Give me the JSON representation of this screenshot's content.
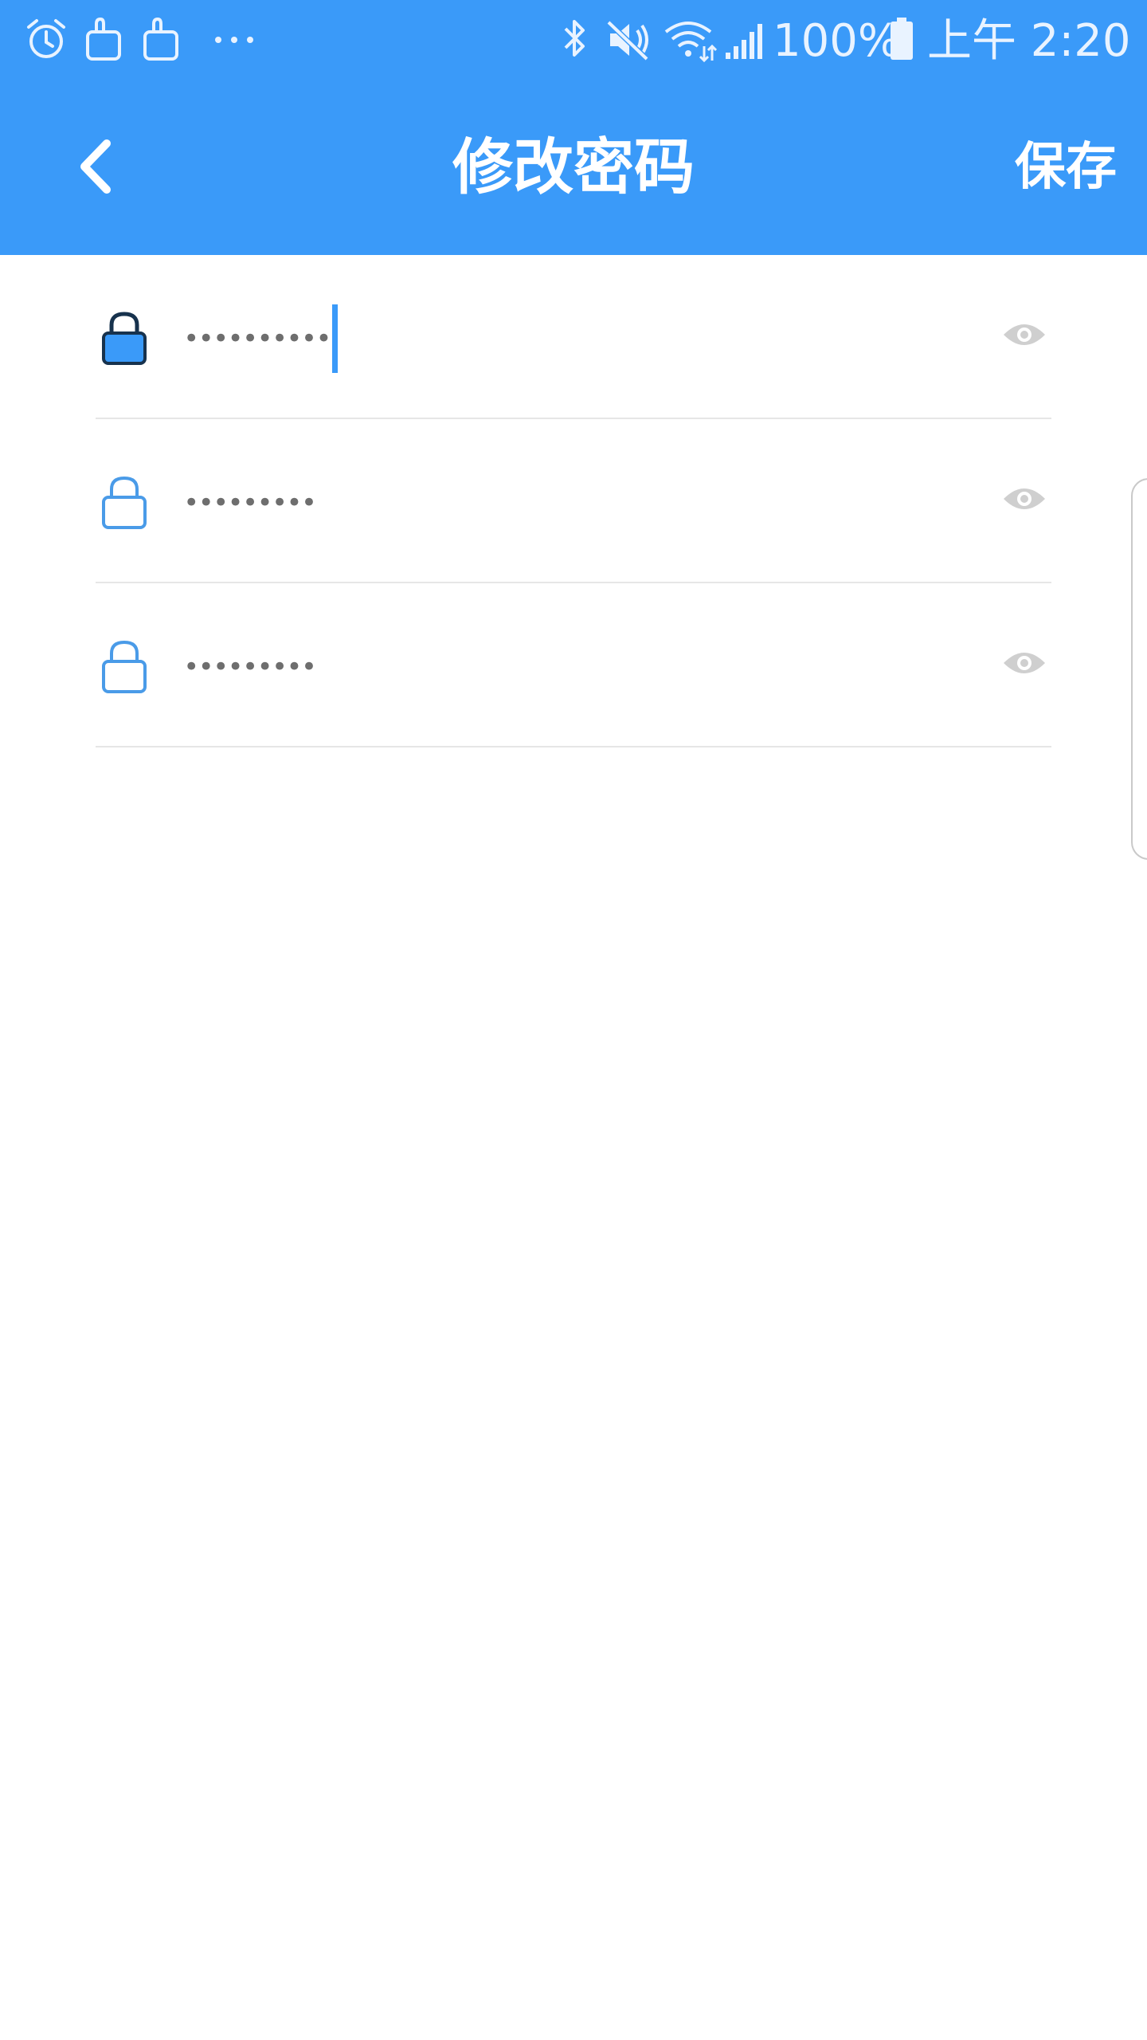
{
  "status_bar": {
    "icons": [
      "alarm-icon",
      "shopping-bag-icon",
      "shopping-bag-icon",
      "more-dots-icon",
      "bluetooth-icon",
      "mute-icon",
      "wifi-icon",
      "signal-icon",
      "battery-icon"
    ],
    "battery": "100%",
    "time": "上午 2:20"
  },
  "app_bar": {
    "title": "修改密码",
    "save_label": "保存",
    "back_icon": "chevron-left-icon",
    "background": "#3a9af9"
  },
  "fields": [
    {
      "mask": "••••••••••",
      "focused": true,
      "icon": "lock-filled-icon"
    },
    {
      "mask": "•••••••••",
      "focused": false,
      "icon": "lock-outline-icon"
    },
    {
      "mask": "•••••••••",
      "focused": false,
      "icon": "lock-outline-icon"
    }
  ],
  "colors": {
    "accent": "#3a9af9",
    "divider": "#e6e6e6",
    "eye": "#cfcfcf"
  }
}
